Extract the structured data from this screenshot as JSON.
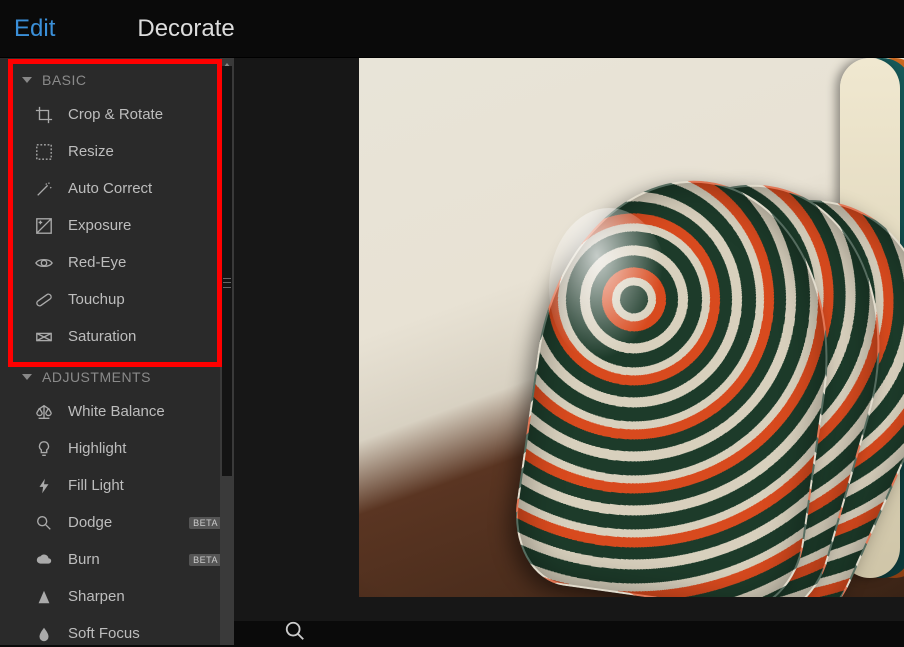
{
  "tabs": {
    "edit": "Edit",
    "decorate": "Decorate"
  },
  "sidebar": {
    "sections": [
      {
        "header": "BASIC",
        "items": [
          {
            "name": "crop-rotate",
            "label": "Crop & Rotate",
            "icon": "crop-icon"
          },
          {
            "name": "resize",
            "label": "Resize",
            "icon": "resize-icon"
          },
          {
            "name": "auto-correct",
            "label": "Auto Correct",
            "icon": "wand-icon"
          },
          {
            "name": "exposure",
            "label": "Exposure",
            "icon": "exposure-icon"
          },
          {
            "name": "red-eye",
            "label": "Red-Eye",
            "icon": "eye-icon"
          },
          {
            "name": "touchup",
            "label": "Touchup",
            "icon": "bandage-icon"
          },
          {
            "name": "saturation",
            "label": "Saturation",
            "icon": "saturation-icon"
          }
        ]
      },
      {
        "header": "ADJUSTMENTS",
        "items": [
          {
            "name": "white-balance",
            "label": "White Balance",
            "icon": "scale-icon"
          },
          {
            "name": "highlight",
            "label": "Highlight",
            "icon": "bulb-icon"
          },
          {
            "name": "fill-light",
            "label": "Fill Light",
            "icon": "bolt-icon"
          },
          {
            "name": "dodge",
            "label": "Dodge",
            "icon": "magnifier-icon",
            "badge": "BETA"
          },
          {
            "name": "burn",
            "label": "Burn",
            "icon": "cloud-icon",
            "badge": "BETA"
          },
          {
            "name": "sharpen",
            "label": "Sharpen",
            "icon": "triangle-icon"
          },
          {
            "name": "soft-focus",
            "label": "Soft Focus",
            "icon": "drop-icon"
          }
        ]
      }
    ]
  },
  "colors": {
    "accent": "#3a8fd8",
    "highlight_border": "#ff0000"
  }
}
